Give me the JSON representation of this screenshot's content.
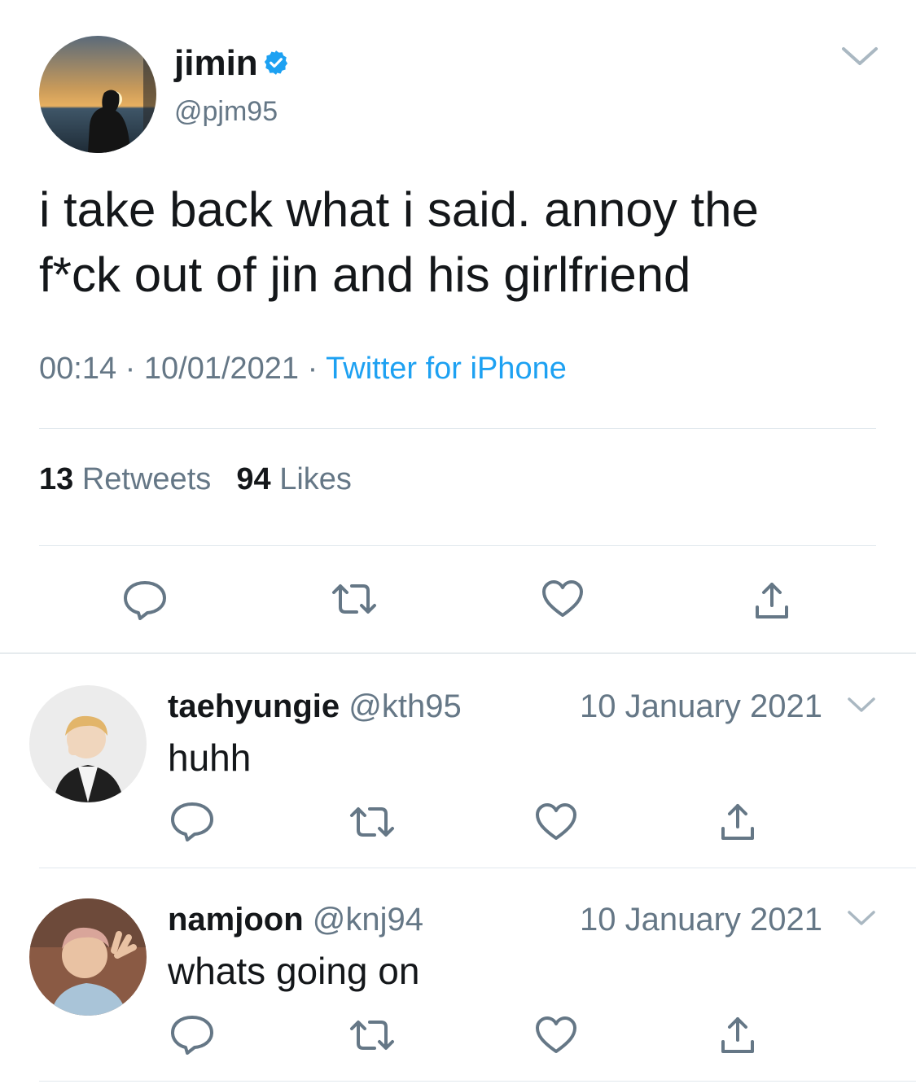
{
  "tweet": {
    "author": {
      "name": "jimin",
      "handle": "@pjm95",
      "verified": true
    },
    "text_line1": "i take back what i said. annoy the",
    "text_line2": "f*ck out of jin and his girlfriend",
    "time": "00:14",
    "date": "10/01/2021",
    "separator": "·",
    "source": "Twitter for iPhone",
    "retweets_count": "13",
    "retweets_label": "Retweets",
    "likes_count": "94",
    "likes_label": "Likes"
  },
  "replies": [
    {
      "name": "taehyungie",
      "handle": "@kth95",
      "date": "10 January 2021",
      "text": "huhh"
    },
    {
      "name": "namjoon",
      "handle": "@knj94",
      "date": "10 January 2021",
      "text": "whats going on"
    }
  ],
  "icons": {
    "verified": "verified-badge-icon",
    "reply": "reply-bubble-icon",
    "retweet": "retweet-arrows-icon",
    "like": "heart-icon",
    "share": "share-upload-icon",
    "menu": "chevron-down-icon"
  },
  "colors": {
    "accent": "#1da1f2",
    "secondary_text": "#657786",
    "divider": "#e1e8ed",
    "text": "#14171a"
  }
}
